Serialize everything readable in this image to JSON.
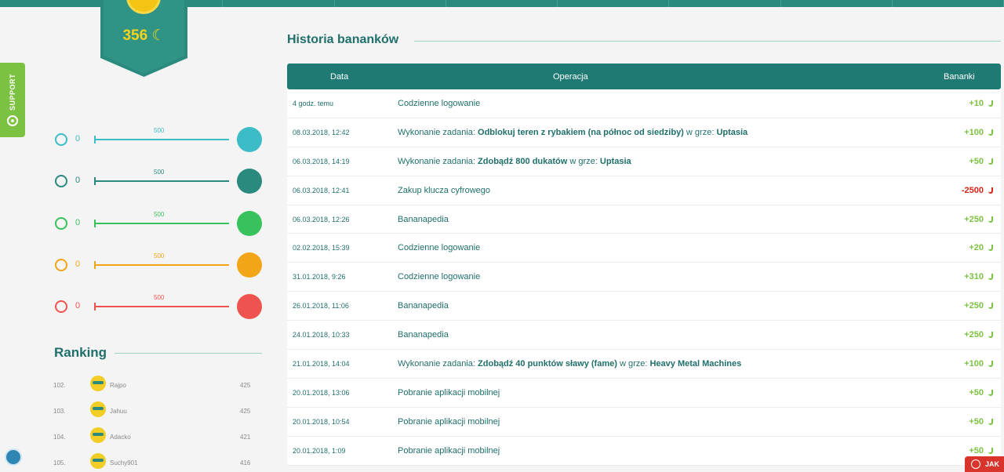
{
  "profile": {
    "points": "356"
  },
  "support": {
    "label": "SUPPORT"
  },
  "stats": [
    {
      "value": "0",
      "max": "500",
      "color": "#3bbcc6",
      "icon": "person-icon"
    },
    {
      "value": "0",
      "max": "500",
      "color": "#2a8a7e",
      "icon": "tie-icon"
    },
    {
      "value": "0",
      "max": "500",
      "color": "#37c25c",
      "icon": "cross-icon"
    },
    {
      "value": "0",
      "max": "500",
      "color": "#f2a516",
      "icon": "face-icon"
    },
    {
      "value": "0",
      "max": "500",
      "color": "#ef5350",
      "icon": "cow-icon"
    }
  ],
  "ranking": {
    "title": "Ranking",
    "rows": [
      {
        "pos": "102.",
        "name": "Rajpo",
        "points": "425"
      },
      {
        "pos": "103.",
        "name": "Jahuu",
        "points": "425"
      },
      {
        "pos": "104.",
        "name": "Adacko",
        "points": "421"
      },
      {
        "pos": "105.",
        "name": "Suchy901",
        "points": "416"
      }
    ]
  },
  "history": {
    "title": "Historia banankow",
    "headers": {
      "date": "Data",
      "operation": "Operacja",
      "bananas": "Bananki"
    },
    "rows": [
      {
        "date": "4 godz. temu",
        "op": "Codzienne logowanie",
        "val": "+10"
      },
      {
        "date": "08.03.2018, 12:42",
        "op": "Wykonanie zadania: Odblokuj teren z rybakiem (na północ od siedziby) w grze: Uptasia",
        "val": "+100"
      },
      {
        "date": "06.03.2018, 14:19",
        "op": "Wykonanie zadania: Zdobądź 800 dukatów w grze: Uptasia",
        "val": "+50"
      },
      {
        "date": "06.03.2018, 12:41",
        "op": "Zakup klucza cyfrowego",
        "val": "-2500"
      },
      {
        "date": "06.03.2018, 12:26",
        "op": "Bananapedia",
        "val": "+250"
      },
      {
        "date": "02.02.2018, 15:39",
        "op": "Codzienne logowanie",
        "val": "+20"
      },
      {
        "date": "31.01.2018, 9:26",
        "op": "Codzienne logowanie",
        "val": "+310"
      },
      {
        "date": "26.01.2018, 11:06",
        "op": "Bananapedia",
        "val": "+250"
      },
      {
        "date": "24.01.2018, 10:33",
        "op": "Bananapedia",
        "val": "+250"
      },
      {
        "date": "21.01.2018, 14:04",
        "op": "Wykonanie zadania: Zdobądź 40 punktów sławy (fame) w grze: Heavy Metal Machines",
        "val": "+100"
      },
      {
        "date": "20.01.2018, 13:06",
        "op": "Pobranie aplikacji mobilnej",
        "val": "+50"
      },
      {
        "date": "20.01.2018, 10:54",
        "op": "Pobranie aplikacji mobilnej",
        "val": "+50"
      },
      {
        "date": "20.01.2018, 1:09",
        "op": "Pobranie aplikacji mobilnej",
        "val": "+50"
      }
    ]
  },
  "video": {
    "label": "JAK"
  }
}
